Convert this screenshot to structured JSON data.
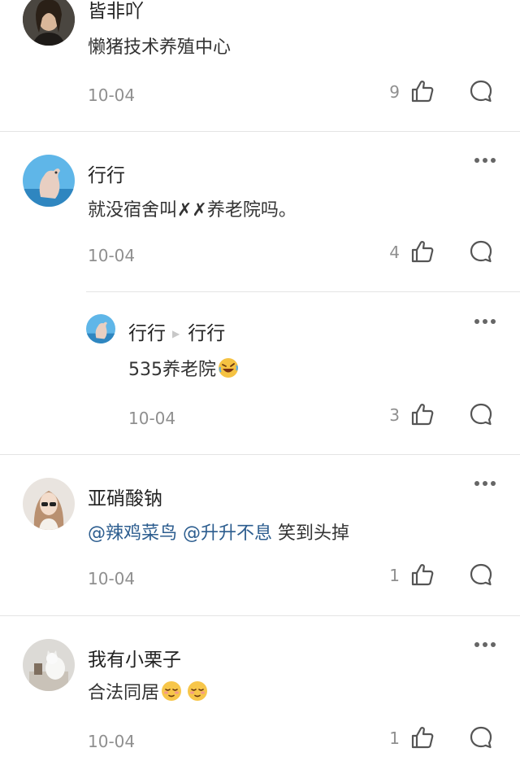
{
  "comments": [
    {
      "username": "皆非吖",
      "text": "懒猪技术养殖中心",
      "date": "10-04",
      "likes": "9"
    },
    {
      "username": "行行",
      "text": "就没宿舍叫✗✗养老院吗。",
      "date": "10-04",
      "likes": "4",
      "reply": {
        "username": "行行",
        "reply_to": "行行",
        "text": "535养老院",
        "emoji": "rolling-on-floor-laughing",
        "date": "10-04",
        "likes": "3"
      }
    },
    {
      "username": "亚硝酸钠",
      "mention1": "@辣鸡菜鸟",
      "mention2": "@升升不息",
      "text": "笑到头掉",
      "date": "10-04",
      "likes": "1"
    },
    {
      "username": "我有小栗子",
      "text": "合法同居",
      "emoji": "relieved-face",
      "date": "10-04",
      "likes": "1"
    }
  ],
  "colors": {
    "mention": "#2c5d8f",
    "meta": "#8f8f8f",
    "divider": "#e4e4e4"
  }
}
